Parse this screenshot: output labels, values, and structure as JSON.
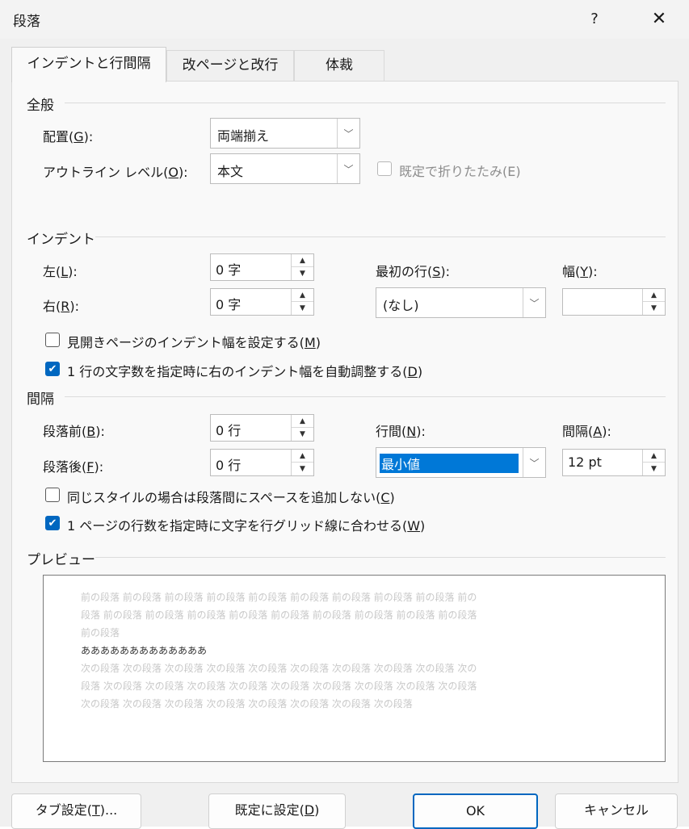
{
  "dialog": {
    "title": "段落",
    "help": "?",
    "close": "✕"
  },
  "tabs": [
    {
      "label": "インデントと行間隔",
      "active": true
    },
    {
      "label": "改ページと改行",
      "active": false
    },
    {
      "label": "体裁",
      "active": false
    }
  ],
  "general": {
    "heading": "全般",
    "alignment": {
      "label_pre": "配置(",
      "key": "G",
      "label_post": "):",
      "value": "両端揃え"
    },
    "outline": {
      "label_pre": "アウトライン レベル(",
      "key": "O",
      "label_post": "):",
      "value": "本文"
    },
    "collapsed": {
      "label": "既定で折りたたみ(E)",
      "checked": false,
      "disabled": true
    }
  },
  "indent": {
    "heading": "インデント",
    "left": {
      "label_pre": "左(",
      "key": "L",
      "label_post": "):",
      "value": "0 字"
    },
    "right": {
      "label_pre": "右(",
      "key": "R",
      "label_post": "):",
      "value": "0 字"
    },
    "first_line": {
      "label_pre": "最初の行(",
      "key": "S",
      "label_post": "):",
      "value": "(なし)"
    },
    "by": {
      "label_pre": "幅(",
      "key": "Y",
      "label_post": "):",
      "value": ""
    },
    "mirror": {
      "label_pre": "見開きページのインデント幅を設定する(",
      "key": "M",
      "label_post": ")",
      "checked": false
    },
    "auto_adjust": {
      "label_pre": "1 行の文字数を指定時に右のインデント幅を自動調整する(",
      "key": "D",
      "label_post": ")",
      "checked": true
    }
  },
  "spacing": {
    "heading": "間隔",
    "before": {
      "label_pre": "段落前(",
      "key": "B",
      "label_post": "):",
      "value": "0 行"
    },
    "after": {
      "label_pre": "段落後(",
      "key": "F",
      "label_post": "):",
      "value": "0 行"
    },
    "line_spacing": {
      "label_pre": "行間(",
      "key": "N",
      "label_post": "):",
      "value": "最小値"
    },
    "at": {
      "label_pre": "間隔(",
      "key": "A",
      "label_post": "):",
      "value": "12 pt"
    },
    "no_space_same_style": {
      "label_pre": "同じスタイルの場合は段落間にスペースを追加しない(",
      "key": "C",
      "label_post": ")",
      "checked": false
    },
    "snap_grid": {
      "label_pre": "1 ページの行数を指定時に文字を行グリッド線に合わせる(",
      "key": "W",
      "label_post": ")",
      "checked": true
    }
  },
  "preview": {
    "heading": "プレビュー",
    "prev_lines": [
      "前の段落 前の段落 前の段落 前の段落 前の段落 前の段落 前の段落 前の段落 前の段落 前の",
      "段落 前の段落 前の段落 前の段落 前の段落 前の段落 前の段落 前の段落 前の段落 前の段落",
      "前の段落"
    ],
    "current_line": "あああああああああああああ",
    "next_lines": [
      "次の段落 次の段落 次の段落 次の段落 次の段落 次の段落 次の段落 次の段落 次の段落 次の",
      "段落 次の段落 次の段落 次の段落 次の段落 次の段落 次の段落 次の段落 次の段落 次の段落",
      "次の段落 次の段落 次の段落 次の段落 次の段落 次の段落 次の段落 次の段落"
    ]
  },
  "buttons": {
    "tabs": {
      "label_pre": "タブ設定(",
      "key": "T",
      "label_post": ")..."
    },
    "default": {
      "label_pre": "既定に設定(",
      "key": "D",
      "label_post": ")"
    },
    "ok": "OK",
    "cancel": "キャンセル"
  },
  "colors": {
    "accent": "#0067c0",
    "selection": "#0078d7"
  }
}
